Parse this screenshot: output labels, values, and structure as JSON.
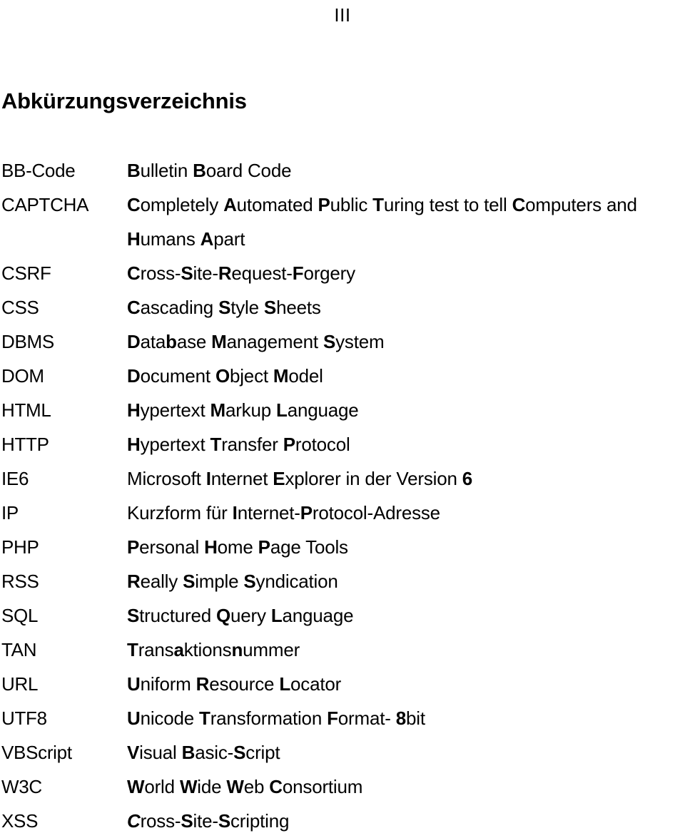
{
  "page": {
    "running_header": "III",
    "heading": "Abkürzungsverzeichnis"
  },
  "abbreviations": [
    {
      "term": "BB-Code",
      "definition": "Bulletin Board Code",
      "parts": [
        {
          "t": "B",
          "s": "bold"
        },
        {
          "t": "ulletin ",
          "s": "normal"
        },
        {
          "t": "B",
          "s": "bold"
        },
        {
          "t": "oard Code",
          "s": "normal"
        }
      ]
    },
    {
      "term": "CAPTCHA",
      "definition": "Completely Automated Public Turing test to tell Computers and Humans Apart",
      "parts": [
        {
          "t": "C",
          "s": "bold"
        },
        {
          "t": "ompletely ",
          "s": "normal"
        },
        {
          "t": "A",
          "s": "bold"
        },
        {
          "t": "utomated ",
          "s": "normal"
        },
        {
          "t": "P",
          "s": "bold"
        },
        {
          "t": "ublic ",
          "s": "normal"
        },
        {
          "t": "T",
          "s": "bold"
        },
        {
          "t": "uring test to tell ",
          "s": "normal"
        },
        {
          "t": "C",
          "s": "bold"
        },
        {
          "t": "omputers and",
          "s": "normal"
        }
      ],
      "continuation_parts": [
        {
          "t": "H",
          "s": "bold"
        },
        {
          "t": "umans ",
          "s": "normal"
        },
        {
          "t": "A",
          "s": "bold"
        },
        {
          "t": "part",
          "s": "normal"
        }
      ],
      "continuation": "Humans Apart"
    },
    {
      "term": "CSRF",
      "definition": "Cross-Site-Request-Forgery",
      "parts": [
        {
          "t": "C",
          "s": "bold"
        },
        {
          "t": "ross-",
          "s": "normal"
        },
        {
          "t": "S",
          "s": "bold"
        },
        {
          "t": "ite-",
          "s": "normal"
        },
        {
          "t": "R",
          "s": "bold"
        },
        {
          "t": "equest-",
          "s": "normal"
        },
        {
          "t": "F",
          "s": "bold"
        },
        {
          "t": "orgery",
          "s": "normal"
        }
      ]
    },
    {
      "term": "CSS",
      "definition": "Cascading Style Sheets",
      "parts": [
        {
          "t": "C",
          "s": "bold"
        },
        {
          "t": "ascading ",
          "s": "normal"
        },
        {
          "t": "S",
          "s": "bold"
        },
        {
          "t": "tyle ",
          "s": "normal"
        },
        {
          "t": "S",
          "s": "bold"
        },
        {
          "t": "heets",
          "s": "normal"
        }
      ]
    },
    {
      "term": "DBMS",
      "definition": "Database Management System",
      "parts": [
        {
          "t": "D",
          "s": "bold"
        },
        {
          "t": "ata",
          "s": "normal"
        },
        {
          "t": "b",
          "s": "bold"
        },
        {
          "t": "ase ",
          "s": "normal"
        },
        {
          "t": "M",
          "s": "bold"
        },
        {
          "t": "anagement ",
          "s": "normal"
        },
        {
          "t": "S",
          "s": "bold"
        },
        {
          "t": "ystem",
          "s": "normal"
        }
      ]
    },
    {
      "term": "DOM",
      "definition": "Document Object Model",
      "parts": [
        {
          "t": "D",
          "s": "bold"
        },
        {
          "t": "ocument ",
          "s": "normal"
        },
        {
          "t": "O",
          "s": "bold"
        },
        {
          "t": "bject ",
          "s": "normal"
        },
        {
          "t": "M",
          "s": "bold"
        },
        {
          "t": "odel",
          "s": "normal"
        }
      ]
    },
    {
      "term": "HTML",
      "definition": "Hypertext Markup Language",
      "parts": [
        {
          "t": "H",
          "s": "bold"
        },
        {
          "t": "ypertext ",
          "s": "normal"
        },
        {
          "t": "M",
          "s": "bold"
        },
        {
          "t": "arkup ",
          "s": "normal"
        },
        {
          "t": "L",
          "s": "bold"
        },
        {
          "t": "anguage",
          "s": "normal"
        }
      ]
    },
    {
      "term": "HTTP",
      "definition": "Hypertext Transfer Protocol",
      "parts": [
        {
          "t": "H",
          "s": "bold"
        },
        {
          "t": "ypertext ",
          "s": "normal"
        },
        {
          "t": "T",
          "s": "bold"
        },
        {
          "t": "ransfer ",
          "s": "normal"
        },
        {
          "t": "P",
          "s": "bold"
        },
        {
          "t": "rotocol",
          "s": "normal"
        }
      ]
    },
    {
      "term": "IE6",
      "definition": "Microsoft Internet Explorer in der Version 6",
      "parts": [
        {
          "t": "Microsoft ",
          "s": "normal"
        },
        {
          "t": "I",
          "s": "bold"
        },
        {
          "t": "nternet ",
          "s": "normal"
        },
        {
          "t": "E",
          "s": "bold"
        },
        {
          "t": "xplorer in der Version ",
          "s": "normal"
        },
        {
          "t": "6",
          "s": "bold"
        }
      ]
    },
    {
      "term": "IP",
      "definition": "Kurzform für Internet-Protocol-Adresse",
      "parts": [
        {
          "t": "Kurzform für ",
          "s": "normal"
        },
        {
          "t": "I",
          "s": "bold"
        },
        {
          "t": "nternet-",
          "s": "normal"
        },
        {
          "t": "P",
          "s": "bold"
        },
        {
          "t": "rotocol-Adresse",
          "s": "normal"
        }
      ]
    },
    {
      "term": "PHP",
      "definition": "Personal Home Page Tools",
      "parts": [
        {
          "t": "P",
          "s": "bold"
        },
        {
          "t": "ersonal ",
          "s": "normal"
        },
        {
          "t": "H",
          "s": "bold"
        },
        {
          "t": "ome ",
          "s": "normal"
        },
        {
          "t": "P",
          "s": "bold"
        },
        {
          "t": "age Tools",
          "s": "normal"
        }
      ]
    },
    {
      "term": "RSS",
      "definition": "Really Simple Syndication",
      "parts": [
        {
          "t": "R",
          "s": "bold"
        },
        {
          "t": "eally ",
          "s": "normal"
        },
        {
          "t": "S",
          "s": "bold"
        },
        {
          "t": "imple ",
          "s": "normal"
        },
        {
          "t": "S",
          "s": "bold"
        },
        {
          "t": "yndication",
          "s": "normal"
        }
      ]
    },
    {
      "term": "SQL",
      "definition": "Structured Query Language",
      "parts": [
        {
          "t": "S",
          "s": "bold"
        },
        {
          "t": "tructured ",
          "s": "normal"
        },
        {
          "t": "Q",
          "s": "bold"
        },
        {
          "t": "uery ",
          "s": "normal"
        },
        {
          "t": "L",
          "s": "bold"
        },
        {
          "t": "anguage",
          "s": "normal"
        }
      ]
    },
    {
      "term": "TAN",
      "definition": "Transaktionsnummer",
      "parts": [
        {
          "t": "T",
          "s": "bold"
        },
        {
          "t": "rans",
          "s": "normal"
        },
        {
          "t": "a",
          "s": "bold"
        },
        {
          "t": "ktions",
          "s": "normal"
        },
        {
          "t": "n",
          "s": "bold"
        },
        {
          "t": "ummer",
          "s": "normal"
        }
      ]
    },
    {
      "term": "URL",
      "definition": "Uniform Resource Locator",
      "parts": [
        {
          "t": "U",
          "s": "bold"
        },
        {
          "t": "niform ",
          "s": "normal"
        },
        {
          "t": "R",
          "s": "bold"
        },
        {
          "t": "esource ",
          "s": "normal"
        },
        {
          "t": "L",
          "s": "bold"
        },
        {
          "t": "ocator",
          "s": "normal"
        }
      ]
    },
    {
      "term": "UTF8",
      "definition": "Unicode Transformation Format- 8bit",
      "parts": [
        {
          "t": "U",
          "s": "bold"
        },
        {
          "t": "nicode ",
          "s": "normal"
        },
        {
          "t": "T",
          "s": "bold"
        },
        {
          "t": "ransformation ",
          "s": "normal"
        },
        {
          "t": "F",
          "s": "bold"
        },
        {
          "t": "ormat- ",
          "s": "normal"
        },
        {
          "t": "8",
          "s": "bold"
        },
        {
          "t": "bit",
          "s": "normal"
        }
      ]
    },
    {
      "term": "VBScript",
      "definition": "Visual Basic-Script",
      "parts": [
        {
          "t": "V",
          "s": "bold"
        },
        {
          "t": "isual ",
          "s": "normal"
        },
        {
          "t": "B",
          "s": "bold"
        },
        {
          "t": "asic-",
          "s": "normal"
        },
        {
          "t": "S",
          "s": "bold"
        },
        {
          "t": "cript",
          "s": "normal"
        }
      ]
    },
    {
      "term": "W3C",
      "definition": "World Wide Web Consortium",
      "parts": [
        {
          "t": "W",
          "s": "bold"
        },
        {
          "t": "orld ",
          "s": "normal"
        },
        {
          "t": "W",
          "s": "bold"
        },
        {
          "t": "ide ",
          "s": "normal"
        },
        {
          "t": "W",
          "s": "bold"
        },
        {
          "t": "eb ",
          "s": "normal"
        },
        {
          "t": "C",
          "s": "bold"
        },
        {
          "t": "onsortium",
          "s": "normal"
        }
      ]
    },
    {
      "term": "XSS",
      "definition": "Cross-Site-Scripting",
      "parts": [
        {
          "t": "C",
          "s": "bold-italic"
        },
        {
          "t": "ross-",
          "s": "normal"
        },
        {
          "t": "S",
          "s": "bold"
        },
        {
          "t": "ite-",
          "s": "normal"
        },
        {
          "t": "S",
          "s": "bold"
        },
        {
          "t": "cripting",
          "s": "normal"
        }
      ]
    }
  ]
}
